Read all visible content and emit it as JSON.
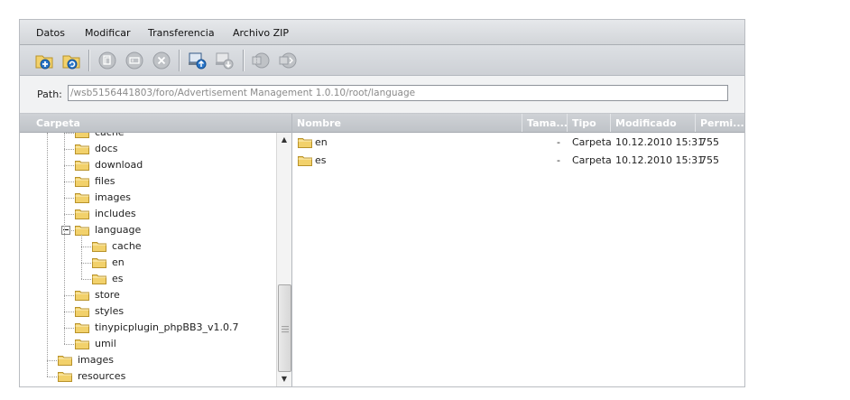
{
  "menu": [
    "Datos",
    "Modificar",
    "Transferencia",
    "Archivo ZIP"
  ],
  "toolbar": {
    "buttons": [
      {
        "name": "new-folder-icon",
        "enabled": true
      },
      {
        "name": "refresh-icon",
        "enabled": true
      },
      {
        "name": "copy-icon",
        "enabled": false
      },
      {
        "name": "rename-icon",
        "enabled": false
      },
      {
        "name": "delete-icon",
        "enabled": false
      },
      {
        "name": "upload-icon",
        "enabled": true
      },
      {
        "name": "download-icon",
        "enabled": false
      },
      {
        "name": "zip-icon",
        "enabled": false
      },
      {
        "name": "unzip-icon",
        "enabled": false
      }
    ]
  },
  "path": {
    "label": "Path:",
    "value": "/wsb5156441803/foro/Advertisement Management 1.0.10/root/language"
  },
  "tree": {
    "header": "Carpeta",
    "items": [
      {
        "label": "cache",
        "level": 2
      },
      {
        "label": "docs",
        "level": 2
      },
      {
        "label": "download",
        "level": 2
      },
      {
        "label": "files",
        "level": 2
      },
      {
        "label": "images",
        "level": 2
      },
      {
        "label": "includes",
        "level": 2
      },
      {
        "label": "language",
        "level": 2,
        "expanded": true
      },
      {
        "label": "cache",
        "level": 3
      },
      {
        "label": "en",
        "level": 3
      },
      {
        "label": "es",
        "level": 3
      },
      {
        "label": "store",
        "level": 2
      },
      {
        "label": "styles",
        "level": 2
      },
      {
        "label": "tinypicplugin_phpBB3_v1.0.7",
        "level": 2
      },
      {
        "label": "umil",
        "level": 2
      },
      {
        "label": "images",
        "level": 1
      },
      {
        "label": "resources",
        "level": 1
      }
    ]
  },
  "list": {
    "columns": [
      "Nombre",
      "Tama...",
      "Tipo",
      "Modificado",
      "Permi..."
    ],
    "rows": [
      {
        "name": "en",
        "size": "-",
        "type": "Carpeta",
        "modified": "10.12.2010 15:31",
        "perm": "755"
      },
      {
        "name": "es",
        "size": "-",
        "type": "Carpeta",
        "modified": "10.12.2010 15:31",
        "perm": "755"
      }
    ]
  },
  "colors": {
    "folder": "#f2d16b",
    "folder_border": "#b8922a",
    "header_text": "#ffffff"
  }
}
